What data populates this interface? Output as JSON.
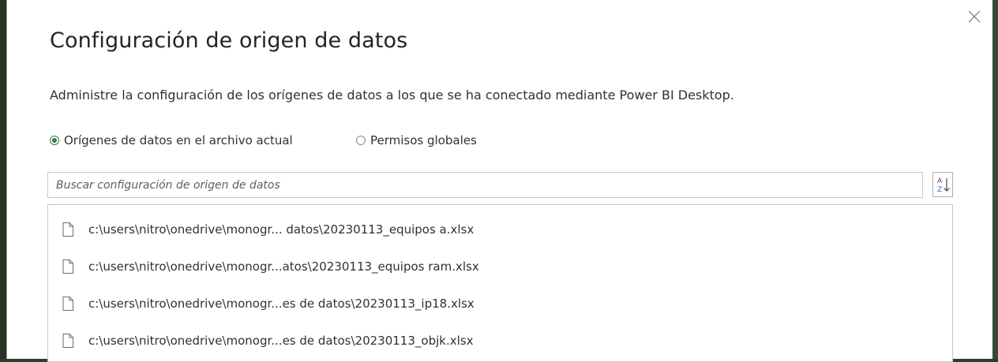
{
  "dialog": {
    "title": "Configuración de origen de datos",
    "description": "Administre la configuración de los orígenes de datos a los que se ha conectado mediante Power BI Desktop.",
    "close_icon": "close-icon"
  },
  "scope": {
    "options": [
      {
        "label": "Orígenes de datos en el archivo actual",
        "selected": true
      },
      {
        "label": "Permisos globales",
        "selected": false
      }
    ]
  },
  "search": {
    "placeholder": "Buscar configuración de origen de datos",
    "value": "",
    "sort_icon": "sort-az-icon"
  },
  "sources": [
    {
      "path": "c:\\users\\nitro\\onedrive\\monogr... datos\\20230113_equipos a.xlsx",
      "icon": "file-icon"
    },
    {
      "path": "c:\\users\\nitro\\onedrive\\monogr...atos\\20230113_equipos ram.xlsx",
      "icon": "file-icon"
    },
    {
      "path": "c:\\users\\nitro\\onedrive\\monogr...es de datos\\20230113_ip18.xlsx",
      "icon": "file-icon"
    },
    {
      "path": "c:\\users\\nitro\\onedrive\\monogr...es de datos\\20230113_objk.xlsx",
      "icon": "file-icon"
    }
  ],
  "colors": {
    "accent_radio": "#3a7a4a",
    "text": "#323130",
    "border": "#c8c6c4"
  }
}
